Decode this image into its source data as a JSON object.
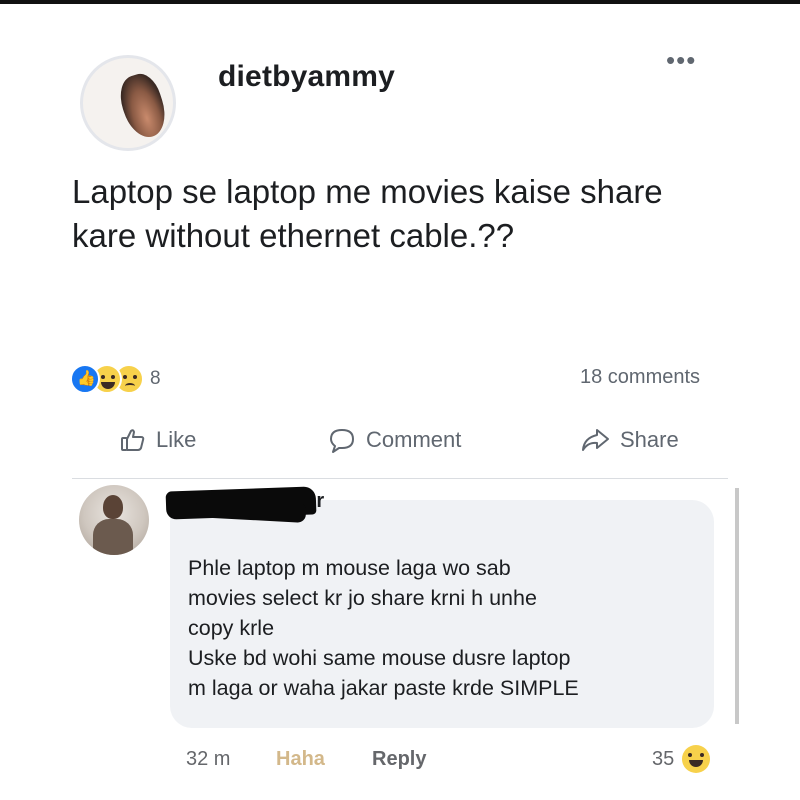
{
  "post": {
    "author": "dietbyammy",
    "more_icon": "•••",
    "text": "Laptop se laptop me movies kaise share kare without ethernet cable.??",
    "reactions": {
      "icons": [
        "like-icon",
        "haha-icon",
        "sad-icon"
      ],
      "count": "8"
    },
    "comments_count": "18 comments"
  },
  "actions": {
    "like": "Like",
    "comment": "Comment",
    "share": "Share"
  },
  "comment": {
    "author_visible": "oor",
    "text_lines": [
      "Phle laptop m mouse laga wo sab",
      "movies select kr jo share krni h unhe",
      "copy krle",
      "Uske bd wohi same mouse dusre laptop",
      "m laga or waha jakar paste krde SIMPLE"
    ],
    "time": "32 m",
    "haha_label": "Haha",
    "reply_label": "Reply",
    "reaction_count": "35",
    "reaction_icon": "haha-icon"
  },
  "colors": {
    "text": "#1c1e21",
    "secondary": "#606770",
    "bubble": "#f0f2f5",
    "like_blue": "#1877f2",
    "haha_yellow": "#f7d14b",
    "haha_label": "#d3b88a"
  }
}
